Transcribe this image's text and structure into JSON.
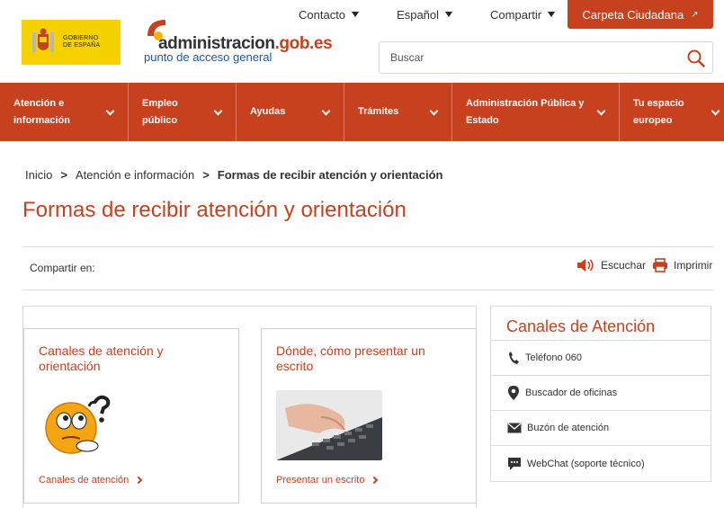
{
  "header": {
    "gov_logo_text": "GOBIERNO DE ESPAÑA",
    "site_name_main": "administracion",
    "site_name_tld": ".gob.es",
    "site_tagline": "punto de acceso general",
    "top_links": [
      {
        "label": "Contacto"
      },
      {
        "label": "Español"
      },
      {
        "label": "Compartir"
      }
    ],
    "folder_button": "Carpeta Ciudadana",
    "search_placeholder": "Buscar"
  },
  "main_menu": [
    {
      "label_1": "Atención e",
      "label_2": "información"
    },
    {
      "label_1": "Empleo",
      "label_2": "público"
    },
    {
      "label_1": "Ayudas",
      "label_2": ""
    },
    {
      "label_1": "Trámites",
      "label_2": ""
    },
    {
      "label_1": "Administración Pública y",
      "label_2": "Estado"
    },
    {
      "label_1": "Tu espacio",
      "label_2": "europeo"
    }
  ],
  "breadcrumb": {
    "items": [
      "Inicio",
      "Atención e información"
    ],
    "current": "Formas de recibir atención y orientación",
    "separator": ">"
  },
  "page": {
    "title": "Formas de recibir atención y orientación",
    "share_label": "Compartir en:",
    "listen_label": "Escuchar",
    "print_label": "Imprimir"
  },
  "cards": [
    {
      "title": "Canales de atención y orientación",
      "link": "Canales de atención"
    },
    {
      "title": "Dónde, cómo presentar un escrito",
      "link": "Presentar un escrito"
    }
  ],
  "side_panel": {
    "title": "Canales de Atención",
    "items": [
      {
        "label": "Teléfono 060",
        "icon": "phone-icon"
      },
      {
        "label": "Buscador de oficinas",
        "icon": "map-pin-icon"
      },
      {
        "label": "Buzón de atención",
        "icon": "envelope-icon"
      },
      {
        "label": "WebChat (soporte técnico)",
        "icon": "chat-icon"
      }
    ]
  },
  "colors": {
    "accent": "#c8411e",
    "link_blue": "#1a5aa8",
    "gov_yellow": "#f6d100"
  }
}
